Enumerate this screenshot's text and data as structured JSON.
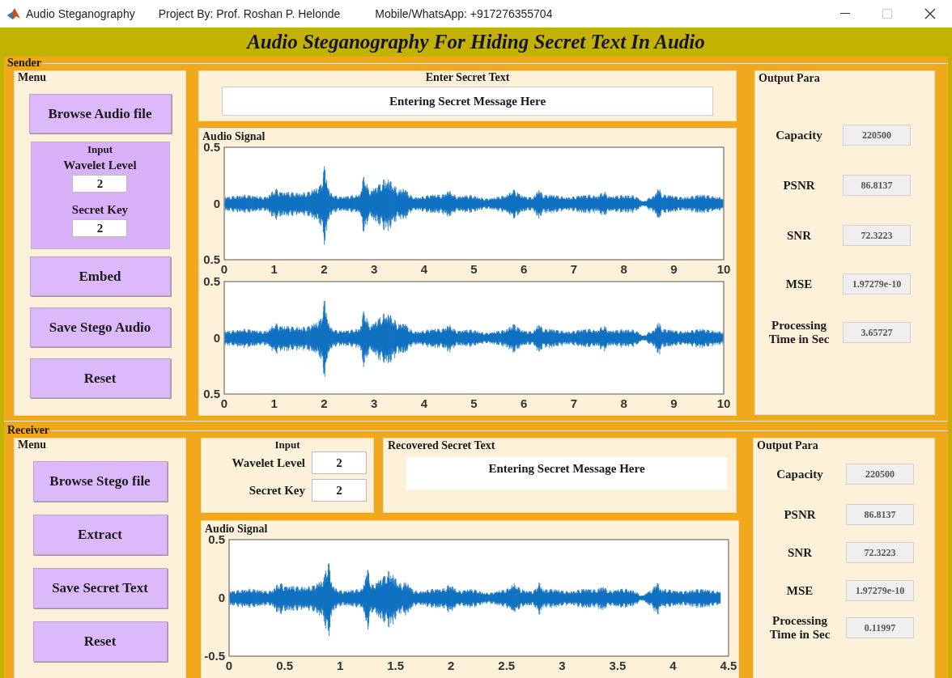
{
  "window": {
    "title": "Audio Steganography",
    "project": "Project By: Prof. Roshan P. Helonde",
    "contact": "Mobile/WhatsApp: +917276355704"
  },
  "heading": "Audio Steganography For Hiding Secret Text In Audio",
  "sender": {
    "label": "Sender",
    "menu": {
      "title": "Menu",
      "first_button": "Browse Audio file",
      "input": {
        "title": "Input",
        "fields": [
          {
            "label": "Wavelet Level",
            "value": "2"
          },
          {
            "label": "Secret Key",
            "value": "2"
          }
        ]
      },
      "buttons": [
        "Embed",
        "Save Stego Audio",
        "Reset"
      ]
    },
    "secret_text": {
      "title": "Enter Secret Text",
      "value": "Entering Secret Message Here"
    },
    "audio_signal": {
      "title": "Audio Signal",
      "plots": [
        {
          "yticks": [
            "0.5",
            "0",
            "0.5"
          ],
          "xticks": [
            "0",
            "1",
            "2",
            "3",
            "4",
            "5",
            "6",
            "7",
            "8",
            "9",
            "10"
          ]
        },
        {
          "yticks": [
            "0.5",
            "0",
            "0.5"
          ],
          "xticks": [
            "0",
            "1",
            "2",
            "3",
            "4",
            "5",
            "6",
            "7",
            "8",
            "9",
            "10"
          ]
        }
      ]
    },
    "output": {
      "title": "Output Para",
      "params": [
        {
          "label": "Capacity",
          "value": "220500"
        },
        {
          "label": "PSNR",
          "value": "86.8137"
        },
        {
          "label": "SNR",
          "value": "72.3223"
        },
        {
          "label": "MSE",
          "value": "1.97279e-10"
        },
        {
          "label": "Processing Time in Sec",
          "value": "3.65727"
        }
      ]
    }
  },
  "receiver": {
    "label": "Receiver",
    "menu": {
      "title": "Menu",
      "buttons": [
        "Browse Stego file",
        "Extract",
        "Save Secret Text",
        "Reset"
      ]
    },
    "input": {
      "title": "Input",
      "fields": [
        {
          "label": "Wavelet Level",
          "value": "2"
        },
        {
          "label": "Secret Key",
          "value": "2"
        }
      ]
    },
    "recovered_text": {
      "title": "Recovered Secret Text",
      "value": "Entering Secret Message Here"
    },
    "audio_signal": {
      "title": "Audio Signal",
      "plots": [
        {
          "yticks": [
            "0.5",
            "0",
            "-0.5"
          ],
          "xticks": [
            "0",
            "0.5",
            "1",
            "1.5",
            "2",
            "2.5",
            "3",
            "3.5",
            "4",
            "4.5"
          ]
        }
      ]
    },
    "output": {
      "title": "Output Para",
      "params": [
        {
          "label": "Capacity",
          "value": "220500"
        },
        {
          "label": "PSNR",
          "value": "86.8137"
        },
        {
          "label": "SNR",
          "value": "72.3223"
        },
        {
          "label": "MSE",
          "value": "1.97279e-10"
        },
        {
          "label": "Processing Time in Sec",
          "value": "0.11997"
        }
      ]
    }
  }
}
